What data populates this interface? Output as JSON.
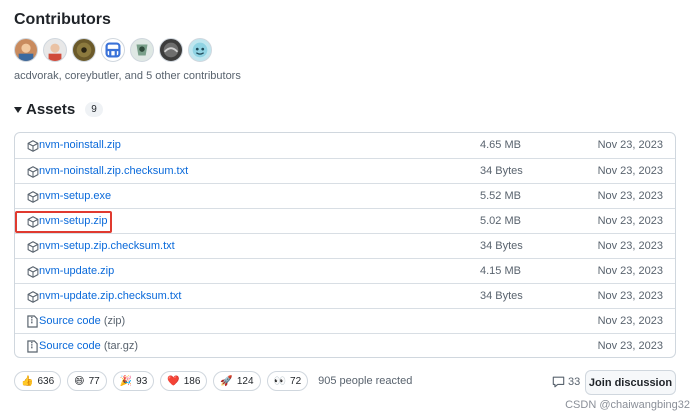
{
  "contributors": {
    "title": "Contributors",
    "summary": "acdvorak, coreybutler, and 5 other contributors",
    "avatars": [
      "avatar-1",
      "avatar-2",
      "avatar-3",
      "avatar-4",
      "avatar-5",
      "avatar-6",
      "avatar-7"
    ]
  },
  "assets": {
    "title": "Assets",
    "count": "9",
    "rows": [
      {
        "name": "nvm-noinstall.zip",
        "size": "4.65 MB",
        "date": "Nov 23, 2023",
        "icon": "package-icon"
      },
      {
        "name": "nvm-noinstall.zip.checksum.txt",
        "size": "34 Bytes",
        "date": "Nov 23, 2023",
        "icon": "package-icon"
      },
      {
        "name": "nvm-setup.exe",
        "size": "5.52 MB",
        "date": "Nov 23, 2023",
        "icon": "package-icon"
      },
      {
        "name": "nvm-setup.zip",
        "size": "5.02 MB",
        "date": "Nov 23, 2023",
        "icon": "package-icon"
      },
      {
        "name": "nvm-setup.zip.checksum.txt",
        "size": "34 Bytes",
        "date": "Nov 23, 2023",
        "icon": "package-icon"
      },
      {
        "name": "nvm-update.zip",
        "size": "4.15 MB",
        "date": "Nov 23, 2023",
        "icon": "package-icon"
      },
      {
        "name": "nvm-update.zip.checksum.txt",
        "size": "34 Bytes",
        "date": "Nov 23, 2023",
        "icon": "package-icon"
      },
      {
        "name": "Source code",
        "suffix": "(zip)",
        "size": "",
        "date": "Nov 23, 2023",
        "icon": "file-zip-icon"
      },
      {
        "name": "Source code",
        "suffix": "(tar.gz)",
        "size": "",
        "date": "Nov 23, 2023",
        "icon": "file-zip-icon"
      }
    ]
  },
  "reactions": {
    "items": [
      {
        "emoji": "👍",
        "count": "636",
        "icon": "thumbs-up-icon"
      },
      {
        "emoji": "😄",
        "count": "77",
        "icon": "smile-icon"
      },
      {
        "emoji": "🎉",
        "count": "93",
        "icon": "tada-icon"
      },
      {
        "emoji": "❤️",
        "count": "186",
        "icon": "heart-icon"
      },
      {
        "emoji": "🚀",
        "count": "124",
        "icon": "rocket-icon"
      },
      {
        "emoji": "👀",
        "count": "72",
        "icon": "eyes-icon"
      }
    ],
    "summary": "905 people reacted"
  },
  "discussion": {
    "comments": "33",
    "button": "Join discussion"
  },
  "watermark": "CSDN @chaiwangbing32",
  "colors": {
    "link": "#0969da",
    "highlight": "#e03a2f",
    "border": "#d0d7de"
  }
}
